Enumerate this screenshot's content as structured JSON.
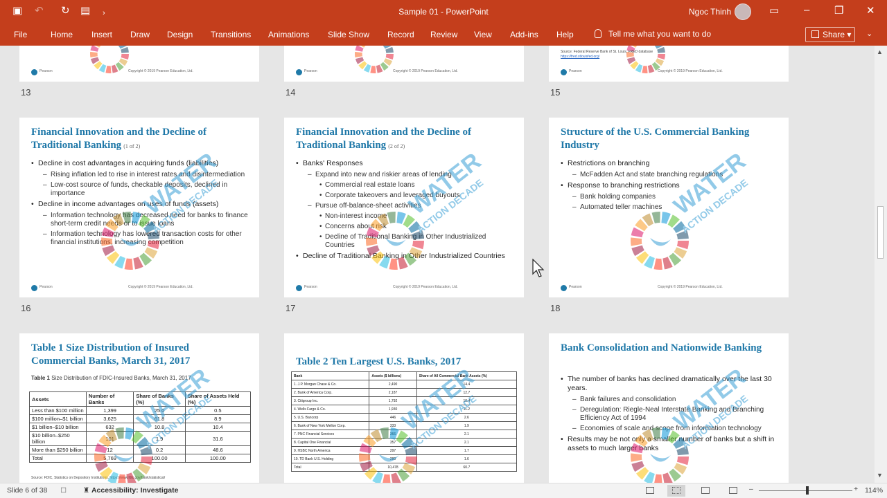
{
  "app": {
    "doc_title": "Sample 01 - PowerPoint",
    "user_name": "Ngoc Thinh"
  },
  "quick_access": [
    "Save",
    "Undo",
    "Redo",
    "Start From Beginning"
  ],
  "ribbon": {
    "tabs": [
      "File",
      "Home",
      "Insert",
      "Draw",
      "Design",
      "Transitions",
      "Animations",
      "Slide Show",
      "Record",
      "Review",
      "View",
      "Add-ins",
      "Help"
    ],
    "tell_me": "Tell me what you want to do",
    "share": "Share"
  },
  "slide_numbers": {
    "n13": "13",
    "n14": "14",
    "n15": "15",
    "n16": "16",
    "n17": "17",
    "n18": "18"
  },
  "slide15": {
    "note_line1": "Source: Federal Reserve Bank of St. Louis, FRED database",
    "note_line2": "https://fred.stlouisfed.org/"
  },
  "footer": {
    "logo_text": "Pearson",
    "copyright": "Copyright © 2019 Pearson Education, Ltd."
  },
  "watermark": {
    "word1": "WATER",
    "word2": "ACTION DECADE"
  },
  "slide16": {
    "title": "Financial Innovation and the Decline of Traditional Banking",
    "sub": "(1 of 2)",
    "bullets": [
      {
        "level": 1,
        "text": "Decline in cost advantages in acquiring funds (liabilities)"
      },
      {
        "level": 2,
        "text": "Rising inflation led to rise in interest rates and disintermediation"
      },
      {
        "level": 2,
        "text": "Low-cost source of funds, checkable deposits, declined in importance"
      },
      {
        "level": 1,
        "text": "Decline in income advantages on uses of funds (assets)"
      },
      {
        "level": 2,
        "text": "Information technology has decreased need for banks to finance short-term credit needs or to issue loans"
      },
      {
        "level": 2,
        "text": "Information technology has lowered transaction costs for other financial institutions, increasing competition"
      }
    ]
  },
  "slide17": {
    "title": "Financial Innovation and the Decline of Traditional Banking",
    "sub": "(2 of 2)",
    "bullets": [
      {
        "level": 1,
        "text": "Banks' Responses"
      },
      {
        "level": 2,
        "text": "Expand into new and riskier areas of lending"
      },
      {
        "level": 3,
        "text": "Commercial real estate loans"
      },
      {
        "level": 3,
        "text": "Corporate takeovers and leveraged buyouts"
      },
      {
        "level": 2,
        "text": "Pursue off-balance-sheet activities"
      },
      {
        "level": 3,
        "text": "Non-interest income"
      },
      {
        "level": 3,
        "text": "Concerns about risk"
      },
      {
        "level": 3,
        "text": "Decline of Traditional Banking in Other Industrialized Countries"
      },
      {
        "level": 1,
        "text": "Decline of Traditional Banking in Other Industrialized Countries"
      }
    ]
  },
  "slide18": {
    "title": "Structure of the U.S. Commercial Banking Industry",
    "bullets": [
      {
        "level": 1,
        "text": "Restrictions on branching"
      },
      {
        "level": 2,
        "text": "McFadden Act and state branching regulations"
      },
      {
        "level": 1,
        "text": "Response to branching restrictions"
      },
      {
        "level": 2,
        "text": "Bank holding companies"
      },
      {
        "level": 2,
        "text": "Automated teller machines"
      }
    ]
  },
  "slide19": {
    "title": "Table 1 Size Distribution of Insured Commercial Banks, March 31, 2017",
    "caption_bold": "Table 1",
    "caption_rest": "Size Distribution of FDIC-Insured Banks, March 31, 2017",
    "headers": [
      "Assets",
      "Number of Banks",
      "Share of Banks (%)",
      "Share of Assets Held (%)"
    ],
    "rows": [
      [
        "Less than $100 million",
        "1,399",
        "25.0",
        "0.5"
      ],
      [
        "$100 million–$1 billion",
        "3,625",
        "61.8",
        "8.9"
      ],
      [
        "$1 billion–$10 billion",
        "632",
        "10.8",
        "10.4"
      ],
      [
        "$10 billion–$250 billion",
        "101",
        "1.9",
        "31.6"
      ],
      [
        "More than $250 billion",
        "12",
        "0.2",
        "48.6"
      ],
      [
        "Total",
        "5,769",
        "100.00",
        "100.00"
      ]
    ],
    "source": "Source: FDIC, Statistics on Depository Institutions, https://www.fdic.gov/bank/statistical/"
  },
  "slide20": {
    "title": "Table 2 Ten Largest U.S. Banks, 2017",
    "headers": [
      "Bank",
      "Assets ($ billions)",
      "Share of All Commercial Bank Assets (%)"
    ],
    "rows": [
      [
        "1. J.P. Morgan Chase & Co.",
        "2,490",
        "14.4"
      ],
      [
        "2. Bank of America Corp.",
        "2,187",
        "12.7"
      ],
      [
        "3. Citigroup Inc.",
        "1,792",
        "10.4"
      ],
      [
        "4. Wells Fargo & Co.",
        "1,930",
        "11.2"
      ],
      [
        "5. U.S. Bancorp",
        "446",
        "2.6"
      ],
      [
        "6. Bank of New York Mellon Corp.",
        "333",
        "1.9"
      ],
      [
        "7. PNC Financial Services",
        "366",
        "2.1"
      ],
      [
        "8. Capital One Financial",
        "357",
        "2.1"
      ],
      [
        "9. HSBC North America",
        "297",
        "1.7"
      ],
      [
        "10. TD Bank U.S. Holding",
        "280",
        "1.6"
      ],
      [
        "Total",
        "10,478",
        "60.7"
      ]
    ]
  },
  "slide21": {
    "title": "Bank Consolidation and Nationwide Banking",
    "bullets": [
      {
        "level": 1,
        "text": "The number of banks has declined dramatically over the last 30 years."
      },
      {
        "level": 2,
        "text": "Bank failures and consolidation"
      },
      {
        "level": 2,
        "text": "Deregulation: Riegle-Neal Interstate Banking and Branching Efficiency Act of 1994"
      },
      {
        "level": 2,
        "text": "Economies of scale and scope from information technology"
      },
      {
        "level": 1,
        "text": "Results may be not only a smaller number of banks but a shift in assets to much larger banks"
      }
    ]
  },
  "status": {
    "slide_info": "Slide 6 of 38",
    "accessibility": "Accessibility: Investigate",
    "zoom": "114%",
    "zoom_fraction": 0.52
  },
  "colors": {
    "accent": "#c43e1c",
    "title_blue": "#1f78a8",
    "watermark_blue": "#3a9fd6"
  }
}
